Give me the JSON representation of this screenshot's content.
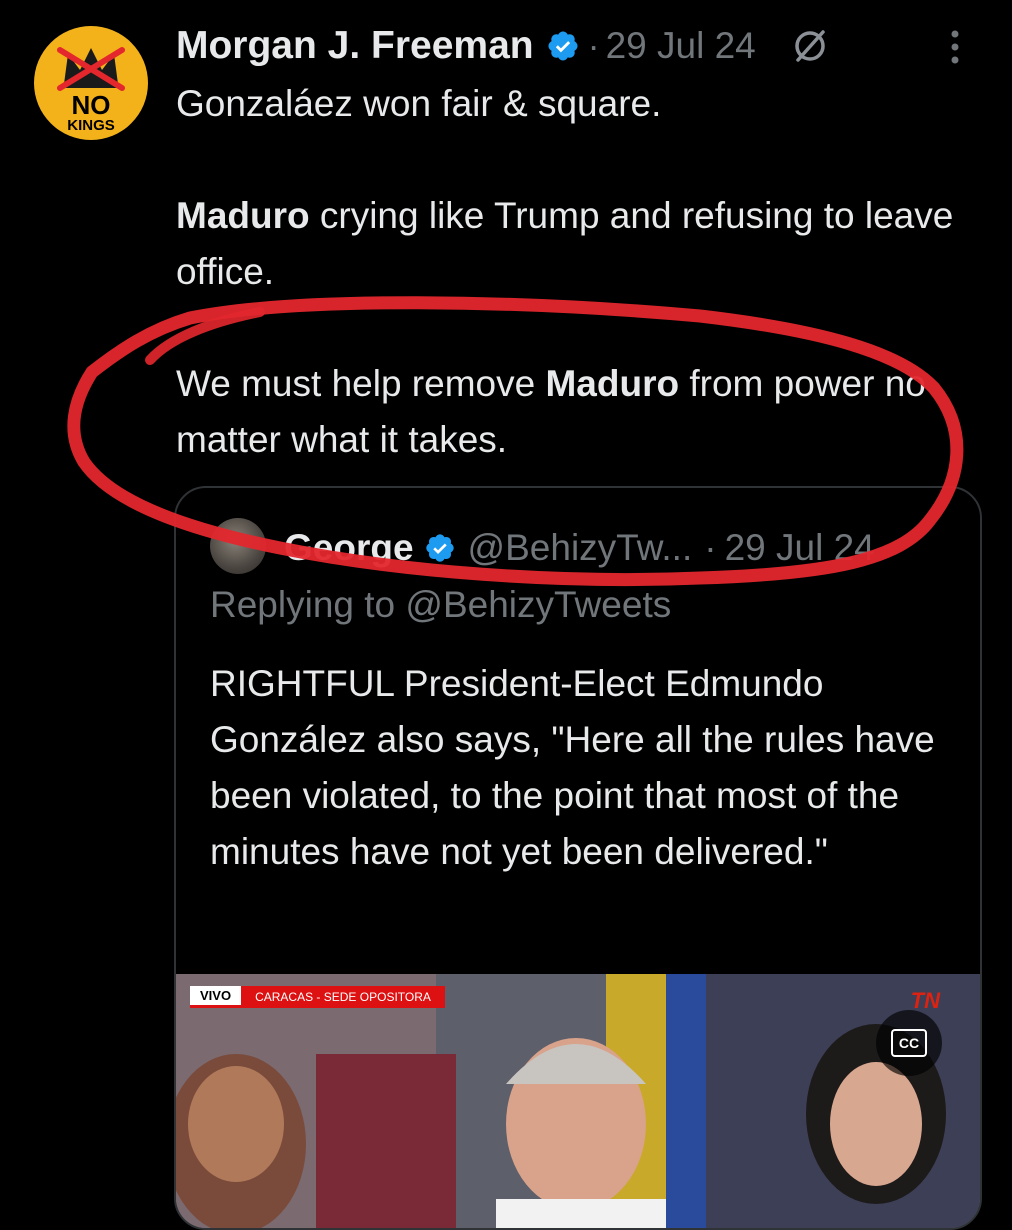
{
  "tweet": {
    "author_name": "Morgan J. Freeman",
    "separator": "·",
    "date": "29 Jul 24",
    "avatar": {
      "word1": "NO",
      "word2": "KINGS",
      "background": "#f3b11a"
    },
    "paragraphs": [
      [
        {
          "text": "Gonzaláez won fair & square.",
          "bold": false
        }
      ],
      [
        {
          "text": "Maduro",
          "bold": true
        },
        {
          "text": " crying like Trump and refusing to leave office.",
          "bold": false
        }
      ],
      [
        {
          "text": "We must help remove ",
          "bold": false
        },
        {
          "text": "Maduro",
          "bold": true
        },
        {
          "text": " from power no matter what it takes.",
          "bold": false
        }
      ]
    ]
  },
  "quoted_tweet": {
    "author_name": "George",
    "handle": "@BehizyTw...",
    "separator": "·",
    "date": "29 Jul 24",
    "replying_to": "Replying to @BehizyTweets",
    "text": "RIGHTFUL President-Elect Edmundo González also says, \"Here all the rules have been violated, to the point that most of the minutes have not yet been delivered.\"",
    "media": {
      "live_label": "VIVO",
      "location_label": "CARACAS - SEDE OPOSITORA",
      "channel_logo": "TN",
      "cc_label": "CC"
    }
  },
  "icons": {
    "verified": "verified-badge-icon",
    "grok": "grok-icon",
    "more": "more-options-icon",
    "captions": "closed-captions-icon"
  },
  "colors": {
    "background": "#000000",
    "text_primary": "#e7e9ea",
    "text_secondary": "#71767b",
    "verified_blue": "#1d9bf0",
    "border": "#2f3336",
    "annotation_red": "#e3272d"
  }
}
